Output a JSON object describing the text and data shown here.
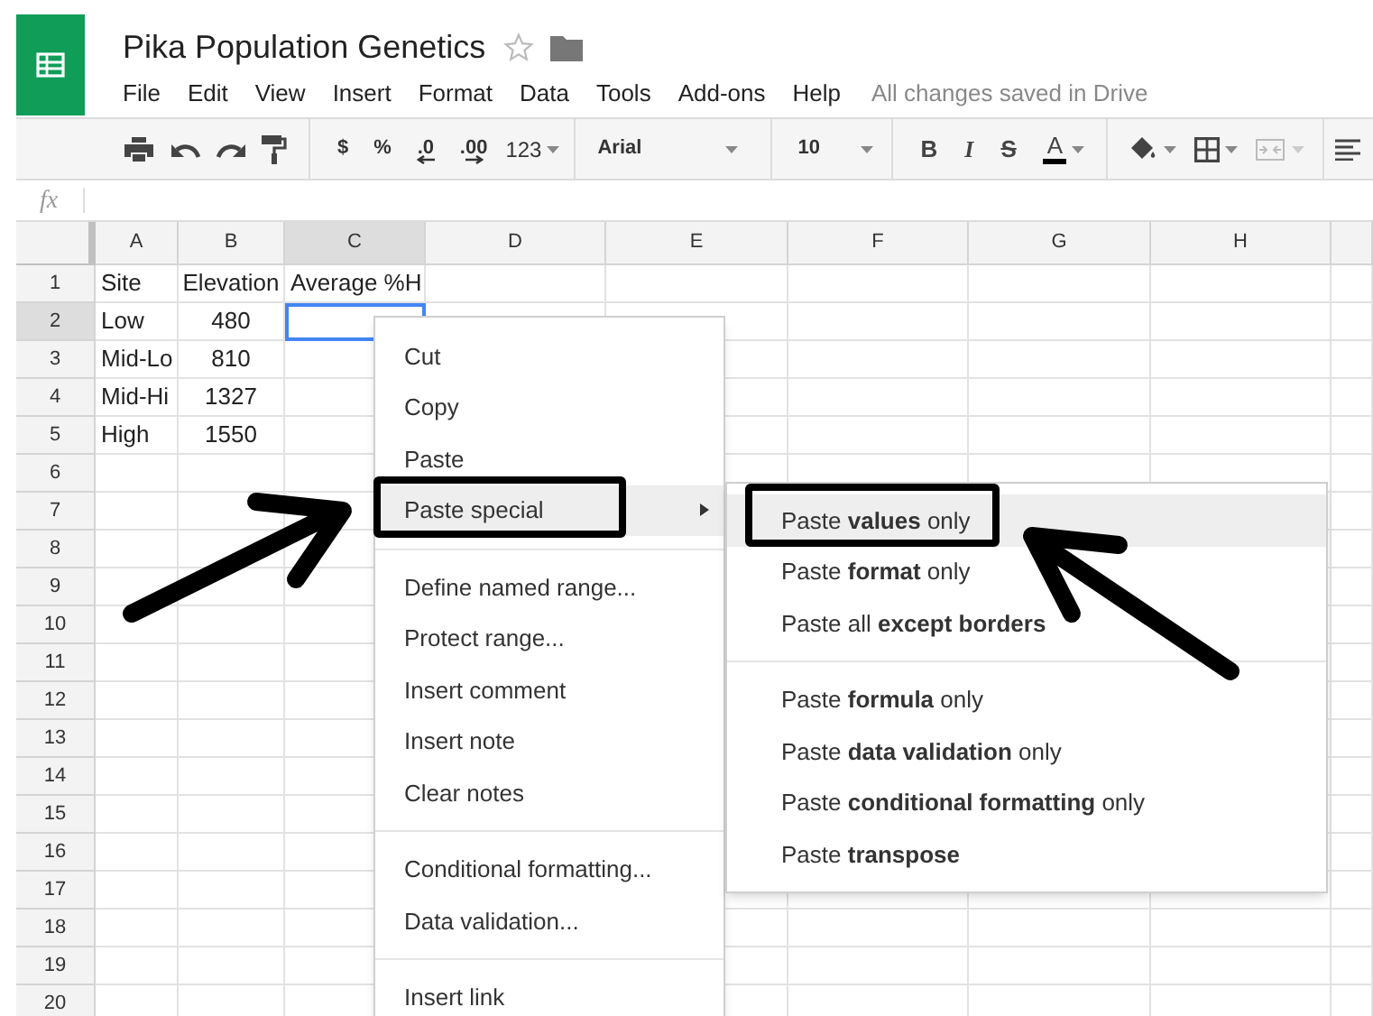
{
  "app": {
    "title": "Pika Population Genetics",
    "starred": false
  },
  "menu_bar": [
    "File",
    "Edit",
    "View",
    "Insert",
    "Format",
    "Data",
    "Tools",
    "Add-ons",
    "Help"
  ],
  "save_status": "All changes saved in Drive",
  "toolbar": {
    "number_buttons": [
      "$",
      "%",
      ".0",
      ".00"
    ],
    "number_format": "123",
    "font": "Arial",
    "font_size": "10",
    "format_buttons": [
      {
        "kind": "bold",
        "label": "B"
      },
      {
        "kind": "italic",
        "label": "I"
      },
      {
        "kind": "strike",
        "label": "S"
      },
      {
        "kind": "color",
        "label": "A"
      }
    ]
  },
  "formula_bar": {
    "label": "fx"
  },
  "sheet": {
    "columns": [
      {
        "label": "A",
        "selected": false
      },
      {
        "label": "B",
        "selected": false
      },
      {
        "label": "C",
        "selected": true
      },
      {
        "label": "D",
        "selected": false
      },
      {
        "label": "E",
        "selected": false
      },
      {
        "label": "F",
        "selected": false
      },
      {
        "label": "G",
        "selected": false
      },
      {
        "label": "H",
        "selected": false
      }
    ],
    "rows": [
      {
        "number": "1",
        "selected": false,
        "cells": [
          "Site",
          "Elevation",
          "Average %H"
        ]
      },
      {
        "number": "2",
        "selected": true,
        "cells": [
          "Low",
          "480"
        ]
      },
      {
        "number": "3",
        "selected": false,
        "cells": [
          "Mid-Lo",
          "810"
        ]
      },
      {
        "number": "4",
        "selected": false,
        "cells": [
          "Mid-Hi",
          "1327"
        ]
      },
      {
        "number": "5",
        "selected": false,
        "cells": [
          "High",
          "1550"
        ]
      },
      {
        "number": "6",
        "selected": false
      },
      {
        "number": "7",
        "selected": false
      },
      {
        "number": "8",
        "selected": false
      },
      {
        "number": "9",
        "selected": false
      },
      {
        "number": "10",
        "selected": false
      },
      {
        "number": "11",
        "selected": false
      },
      {
        "number": "12",
        "selected": false
      },
      {
        "number": "13",
        "selected": false
      },
      {
        "number": "14",
        "selected": false
      },
      {
        "number": "15",
        "selected": false
      },
      {
        "number": "16",
        "selected": false
      },
      {
        "number": "17",
        "selected": false
      },
      {
        "number": "18",
        "selected": false
      },
      {
        "number": "19",
        "selected": false
      },
      {
        "number": "20",
        "selected": false
      }
    ]
  },
  "context_menu": {
    "items": [
      {
        "kind": "item",
        "label": "Cut",
        "selected": false
      },
      {
        "kind": "item",
        "label": "Copy",
        "selected": false
      },
      {
        "kind": "item",
        "label": "Paste",
        "selected": false
      },
      {
        "kind": "item",
        "label": "Paste special",
        "selected": true,
        "has_submenu": true,
        "outlined": true
      },
      {
        "kind": "separator"
      },
      {
        "kind": "item",
        "label": "Define named range...",
        "selected": false
      },
      {
        "kind": "item",
        "label": "Protect range...",
        "selected": false
      },
      {
        "kind": "item",
        "label": "Insert comment",
        "selected": false
      },
      {
        "kind": "item",
        "label": "Insert note",
        "selected": false
      },
      {
        "kind": "item",
        "label": "Clear notes",
        "selected": false
      },
      {
        "kind": "separator"
      },
      {
        "kind": "item",
        "label": "Conditional formatting...",
        "selected": false
      },
      {
        "kind": "item",
        "label": "Data validation...",
        "selected": false
      },
      {
        "kind": "separator"
      },
      {
        "kind": "item",
        "label": "Insert link",
        "selected": false
      }
    ]
  },
  "submenu": {
    "items": [
      {
        "kind": "item",
        "label": "Paste **values** only",
        "selected": true,
        "outlined": true
      },
      {
        "kind": "item",
        "label": "Paste **format** only",
        "selected": false
      },
      {
        "kind": "item",
        "label": "Paste all **except borders**",
        "selected": false
      },
      {
        "kind": "separator"
      },
      {
        "kind": "item",
        "label": "Paste **formula** only",
        "selected": false
      },
      {
        "kind": "item",
        "label": "Paste **data validation** only",
        "selected": false
      },
      {
        "kind": "item",
        "label": "Paste **conditional formatting** only",
        "selected": false
      },
      {
        "kind": "item",
        "label": "Paste **transpose**",
        "selected": false
      }
    ]
  }
}
